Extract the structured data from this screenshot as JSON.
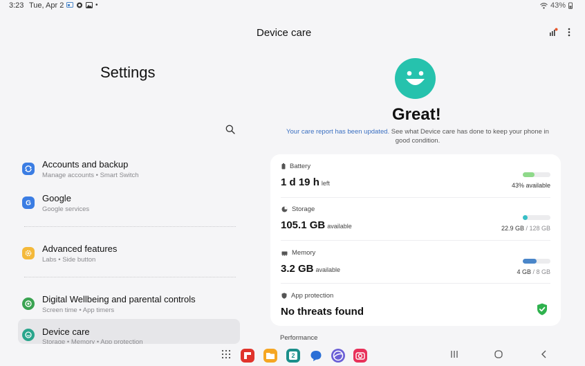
{
  "status_bar": {
    "time": "3:23",
    "date": "Tue, Apr 2",
    "battery": "43%"
  },
  "settings": {
    "title": "Settings",
    "items": [
      {
        "label": "Accounts and backup",
        "sub": "Manage accounts  •  Smart Switch",
        "icon": "sync-icon",
        "color": "#3b7de3"
      },
      {
        "label": "Google",
        "sub": "Google services",
        "icon": "google-icon",
        "color": "#3b7de3"
      },
      {
        "label": "Advanced features",
        "sub": "Labs  •  Side button",
        "icon": "gear-plus-icon",
        "color": "#f4b93a"
      },
      {
        "label": "Digital Wellbeing and parental controls",
        "sub": "Screen time  •  App timers",
        "icon": "wellbeing-icon",
        "color": "#3aa351"
      },
      {
        "label": "Device care",
        "sub": "Storage  •  Memory  •  App protection",
        "icon": "device-care-icon",
        "color": "#2aa58c"
      }
    ]
  },
  "device_care": {
    "title": "Device care",
    "status": "Great!",
    "report_link": "Your care report has been updated.",
    "report_text": " See what Device care has done to keep your phone in good condition.",
    "battery": {
      "label": "Battery",
      "value": "1 d 19 h",
      "unit": "left",
      "meta": "43% available",
      "fraction": 0.43,
      "color": "#8fd98a"
    },
    "storage": {
      "label": "Storage",
      "value": "105.1 GB",
      "unit": "available",
      "meta_used": "22.9 GB",
      "meta_total": " / 128 GB",
      "fraction": 0.18,
      "color": "#37bfc6"
    },
    "memory": {
      "label": "Memory",
      "value": "3.2 GB",
      "unit": "available",
      "meta_used": "4 GB",
      "meta_total": " / 8 GB",
      "fraction": 0.5,
      "color": "#4a86c9"
    },
    "app_protection": {
      "label": "App protection",
      "value": "No threats found"
    },
    "performance_label": "Performance"
  },
  "dock": {
    "apps": [
      {
        "name": "flipboard-icon",
        "color": "#e0342c"
      },
      {
        "name": "files-icon",
        "color": "#f5a623"
      },
      {
        "name": "calendar-icon",
        "color": "#1b8f8a",
        "text": "2"
      },
      {
        "name": "messages-icon",
        "color": "#2a6fd6"
      },
      {
        "name": "internet-icon",
        "color": "#6b5fd6"
      },
      {
        "name": "camera-icon",
        "color": "#e8315a"
      }
    ]
  }
}
